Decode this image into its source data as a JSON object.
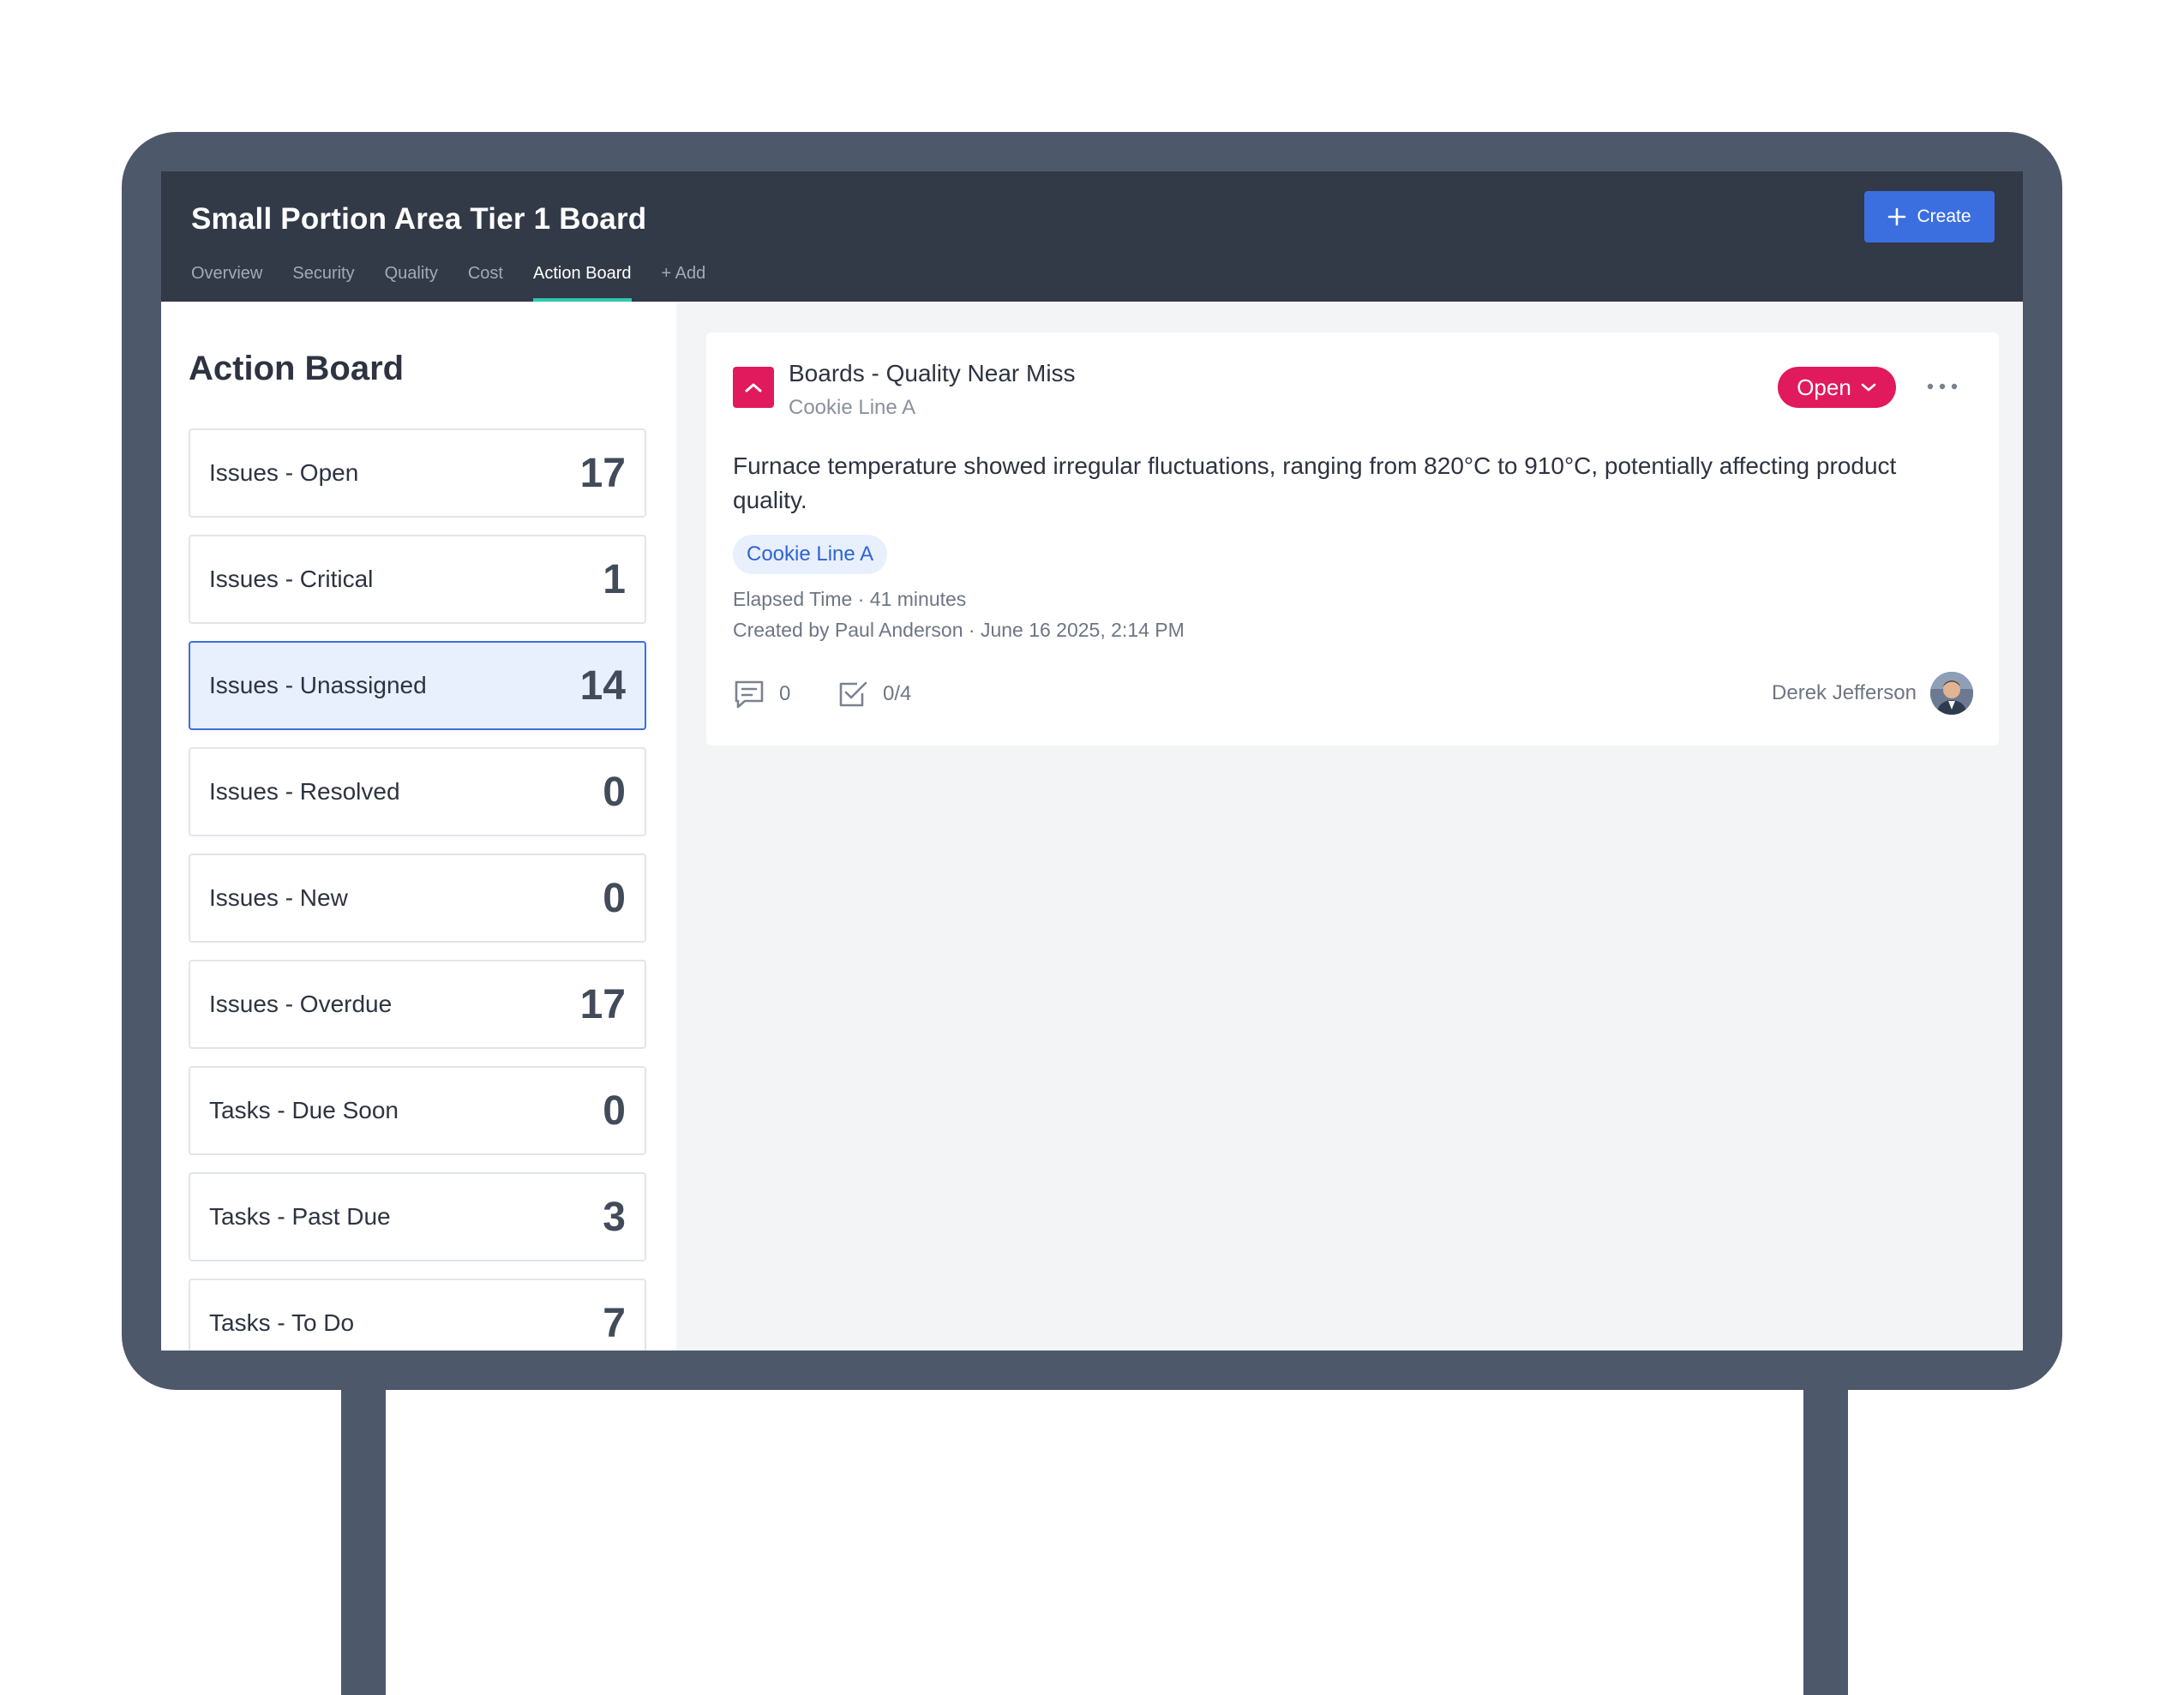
{
  "header": {
    "board_title": "Small Portion Area Tier 1 Board",
    "create_label": "Create",
    "tabs": [
      {
        "label": "Overview"
      },
      {
        "label": "Security"
      },
      {
        "label": "Quality"
      },
      {
        "label": "Cost"
      },
      {
        "label": "Action Board",
        "active": true
      },
      {
        "label": "+ Add"
      }
    ]
  },
  "sidebar": {
    "title": "Action Board",
    "stats": [
      {
        "label": "Issues - Open",
        "value": "17"
      },
      {
        "label": "Issues - Critical",
        "value": "1"
      },
      {
        "label": "Issues - Unassigned",
        "value": "14",
        "selected": true
      },
      {
        "label": "Issues - Resolved",
        "value": "0"
      },
      {
        "label": "Issues - New",
        "value": "0"
      },
      {
        "label": "Issues - Overdue",
        "value": "17"
      },
      {
        "label": "Tasks - Due Soon",
        "value": "0"
      },
      {
        "label": "Tasks - Past Due",
        "value": "3"
      },
      {
        "label": "Tasks - To Do",
        "value": "7"
      }
    ]
  },
  "issue": {
    "title": "Boards - Quality Near Miss",
    "subtitle": "Cookie Line A",
    "status": "Open",
    "description": "Furnace temperature showed irregular fluctuations, ranging from 820°C to 910°C, potentially affecting product quality.",
    "tag": "Cookie Line A",
    "elapsed": "Elapsed Time · 41 minutes",
    "created": "Created by Paul Anderson · June 16 2025, 2:14 PM",
    "comments_count": "0",
    "tasks_progress": "0/4",
    "assignee": "Derek Jefferson",
    "priority_icon": "chevron-up-icon"
  },
  "colors": {
    "header_bg": "#323947",
    "accent": "#3b6fe0",
    "critical": "#e01a5c",
    "tab_underline": "#2fc8b0",
    "frame": "#4d596b"
  }
}
